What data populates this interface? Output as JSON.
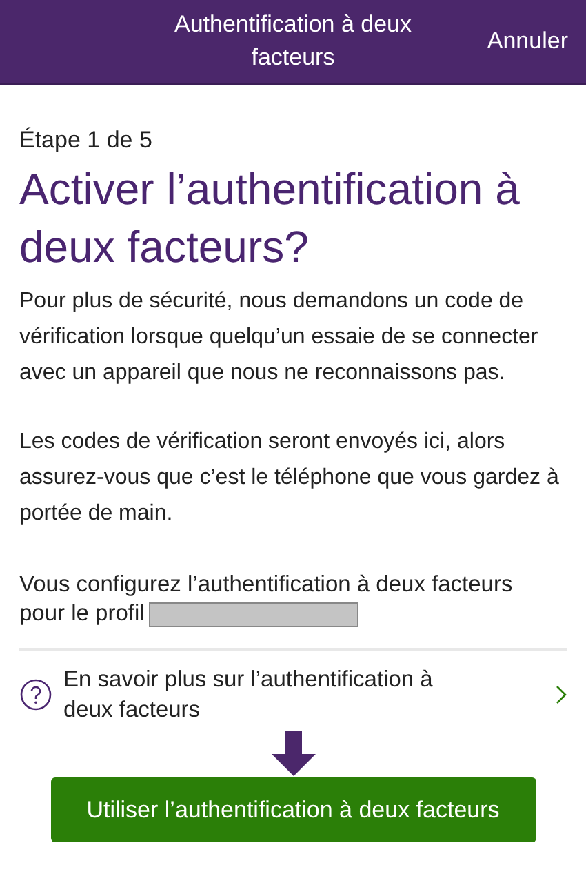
{
  "header": {
    "title": "Authentification à deux facteurs",
    "cancel": "Annuler"
  },
  "step": "Étape 1 de 5",
  "heading": "Activer l’authentification à deux facteurs?",
  "paragraphs": [
    "Pour plus de sécurité, nous demandons un code de vérification lorsque quelqu’un essaie de se connecter avec un appareil que nous ne reconnaissons pas.",
    "Les codes de vérification seront envoyés ici, alors assurez-vous que c’est le téléphone que vous gardez à portée de main."
  ],
  "profile_note": "Vous configurez l’authentification à deux facteurs",
  "profile_label": "pour le profil",
  "learn_more": "En savoir plus sur l’authentification à deux facteurs",
  "primary_button": "Utiliser l’authentification à deux facteurs"
}
